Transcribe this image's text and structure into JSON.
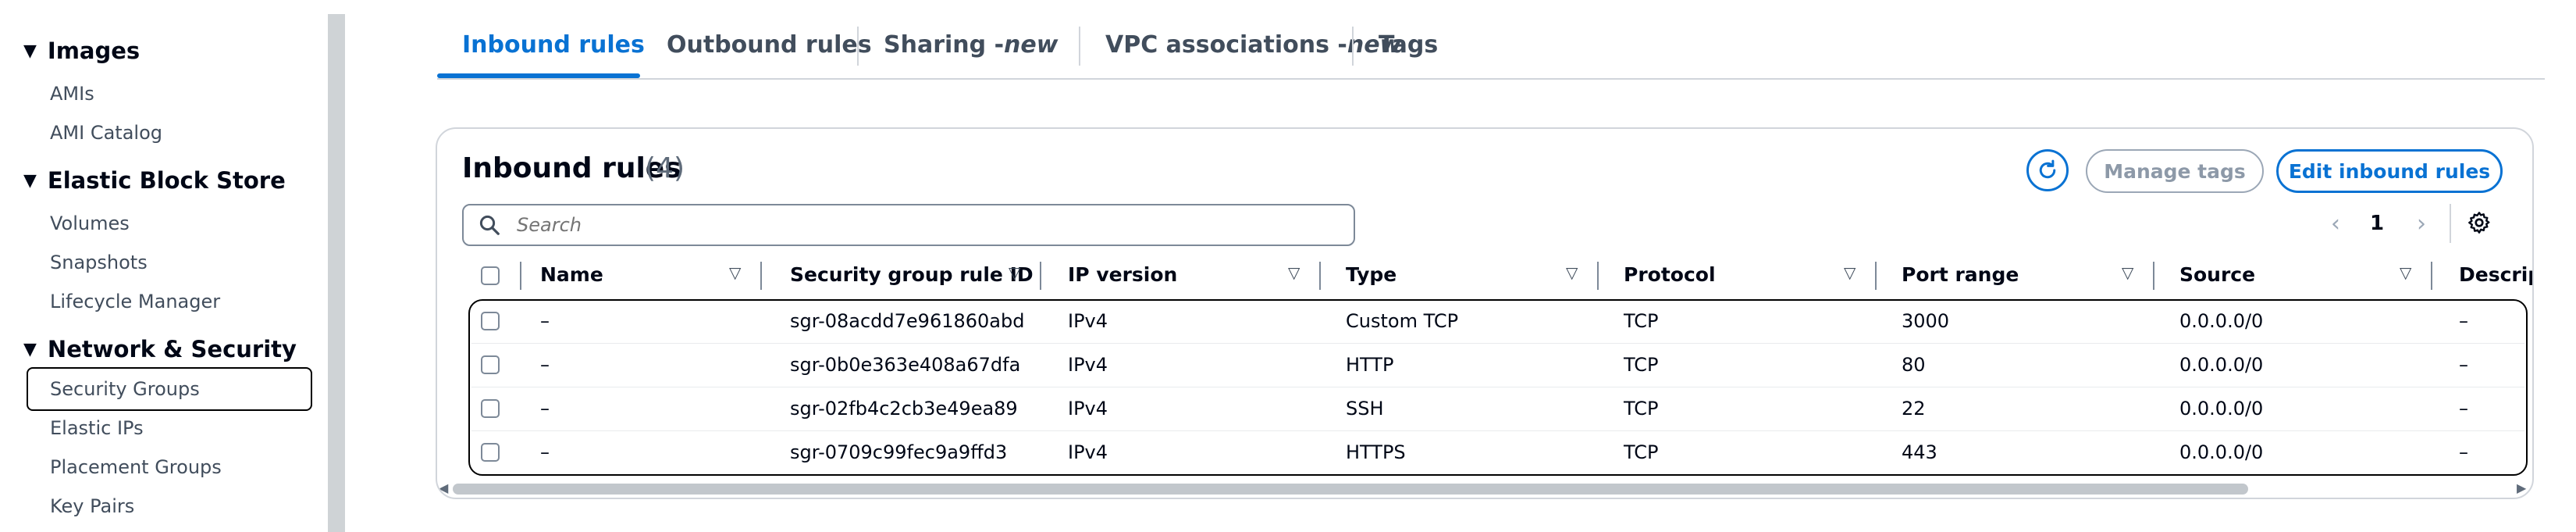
{
  "sidebar": {
    "sections": [
      {
        "title": "Images",
        "items": [
          "AMIs",
          "AMI Catalog"
        ]
      },
      {
        "title": "Elastic Block Store",
        "items": [
          "Volumes",
          "Snapshots",
          "Lifecycle Manager"
        ]
      },
      {
        "title": "Network & Security",
        "items": [
          "Security Groups",
          "Elastic IPs",
          "Placement Groups",
          "Key Pairs"
        ]
      }
    ],
    "active_item": "Security Groups"
  },
  "tabs": {
    "inbound": "Inbound rules",
    "outbound": "Outbound rules",
    "sharing": "Sharing - ",
    "sharing_new": "new",
    "vpc": "VPC associations - ",
    "vpc_new": "new",
    "tags": "Tags",
    "active": "Inbound rules"
  },
  "panel": {
    "title": "Inbound rules",
    "count": "(4)",
    "manage_tags": "Manage tags",
    "edit_inbound": "Edit inbound rules",
    "search_placeholder": "Search",
    "page": "1"
  },
  "table": {
    "columns": [
      "Name",
      "Security group rule ID",
      "IP version",
      "Type",
      "Protocol",
      "Port range",
      "Source",
      "Descripti"
    ],
    "rows": [
      {
        "name": "–",
        "id": "sgr-08acdd7e961860abd",
        "ip": "IPv4",
        "type": "Custom TCP",
        "protocol": "TCP",
        "port": "3000",
        "source": "0.0.0.0/0",
        "desc": "–"
      },
      {
        "name": "–",
        "id": "sgr-0b0e363e408a67dfa",
        "ip": "IPv4",
        "type": "HTTP",
        "protocol": "TCP",
        "port": "80",
        "source": "0.0.0.0/0",
        "desc": "–"
      },
      {
        "name": "–",
        "id": "sgr-02fb4c2cb3e49ea89",
        "ip": "IPv4",
        "type": "SSH",
        "protocol": "TCP",
        "port": "22",
        "source": "0.0.0.0/0",
        "desc": "–"
      },
      {
        "name": "–",
        "id": "sgr-0709c99fec9a9ffd3",
        "ip": "IPv4",
        "type": "HTTPS",
        "protocol": "TCP",
        "port": "443",
        "source": "0.0.0.0/0",
        "desc": "–"
      }
    ]
  },
  "icons": {
    "refresh": "refresh-icon",
    "search": "search-icon",
    "prev": "chevron-left-icon",
    "next": "chevron-right-icon",
    "settings": "gear-icon",
    "filter": "sort-filter-icon",
    "collapse": "caret-down-icon"
  },
  "colors": {
    "accent": "#0972d3",
    "text": "#000716",
    "muted": "#5f6b7a",
    "border": "#7d8998"
  }
}
